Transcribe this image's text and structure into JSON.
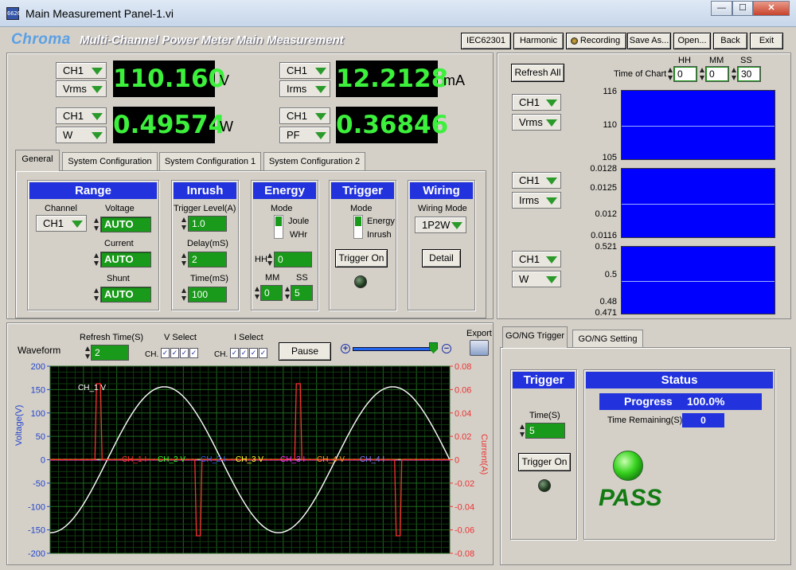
{
  "window": {
    "title": "Main Measurement Panel-1.vi",
    "icon_text": "6626",
    "min": "—",
    "restore": "☐",
    "close": "✕"
  },
  "header": {
    "logo": "Chroma",
    "title": "Multi-Channel Power Meter Main Measurement",
    "buttons": [
      "IEC62301",
      "Harmonic",
      "Recording",
      "Save As...",
      "Open...",
      "Back",
      "Exit"
    ]
  },
  "meters": [
    {
      "channel": "CH1",
      "param": "Vrms",
      "value": "110.160",
      "unit": "V"
    },
    {
      "channel": "CH1",
      "param": "Irms",
      "value": "12.2128",
      "unit": "mA"
    },
    {
      "channel": "CH1",
      "param": "W",
      "value": "0.49574",
      "unit": "W"
    },
    {
      "channel": "CH1",
      "param": "PF",
      "value": "0.36846",
      "unit": ""
    }
  ],
  "tabs": [
    "General",
    "System Configuration",
    "System Configuration 1",
    "System Configuration 2"
  ],
  "range": {
    "title": "Range",
    "channel_label": "Channel",
    "channel": "CH1",
    "voltage_label": "Voltage",
    "voltage": "AUTO",
    "current_label": "Current",
    "current": "AUTO",
    "shunt_label": "Shunt",
    "shunt": "AUTO"
  },
  "inrush": {
    "title": "Inrush",
    "trigger_label": "Trigger Level(A)",
    "trigger": "1.0",
    "delay_label": "Delay(mS)",
    "delay": "2",
    "time_label": "Time(mS)",
    "time": "100"
  },
  "energy": {
    "title": "Energy",
    "mode_label": "Mode",
    "opt1": "Joule",
    "opt2": "WHr",
    "hh_label": "HH",
    "hh": "0",
    "mm_label": "MM",
    "mm": "0",
    "ss_label": "SS",
    "ss": "5"
  },
  "trigger": {
    "title": "Trigger",
    "mode_label": "Mode",
    "opt1": "Energy",
    "opt2": "Inrush",
    "button": "Trigger On"
  },
  "wiring": {
    "title": "Wiring",
    "mode_label": "Wiring Mode",
    "mode": "1P2W",
    "button": "Detail"
  },
  "trend": {
    "refresh": "Refresh All",
    "time_label": "Time of Chart",
    "hh_label": "HH",
    "hh": "0",
    "mm_label": "MM",
    "mm": "0",
    "ss_label": "SS",
    "ss": "30",
    "charts": [
      {
        "channel": "CH1",
        "param": "Vrms",
        "ticks": [
          "116",
          "110",
          "105"
        ]
      },
      {
        "channel": "CH1",
        "param": "Irms",
        "ticks": [
          "0.0128",
          "0.0125",
          "0.012",
          "0.0116"
        ]
      },
      {
        "channel": "CH1",
        "param": "W",
        "ticks": [
          "0.521",
          "0.5",
          "0.48",
          "0.471"
        ]
      }
    ]
  },
  "waveform": {
    "title": "Waveform",
    "refresh_label": "Refresh Time(S)",
    "refresh": "2",
    "vsel_label": "V Select",
    "isel_label": "I Select",
    "ch_label": "CH.",
    "pause": "Pause",
    "export": "Export",
    "ylabel": "Voltage(V)",
    "y2label": "Current(A)",
    "yticks": [
      "200",
      "150",
      "100",
      "50",
      "0",
      "-50",
      "-100",
      "-150",
      "-200"
    ],
    "y2ticks": [
      "0.08",
      "0.06",
      "0.04",
      "0.02",
      "0",
      "-0.02",
      "-0.04",
      "-0.06",
      "-0.08"
    ],
    "trace_labels": [
      "CH_1 V",
      "CH_1 I",
      "CH_2 V",
      "CH_2 I",
      "CH_3 V",
      "CH_3 I",
      "CH_4 V",
      "CH_4 I"
    ],
    "trace_colors": [
      "#ffffff",
      "#ff3030",
      "#30ff30",
      "#3060ff",
      "#ffff30",
      "#ff30ff",
      "#ffa020",
      "#8080ff"
    ]
  },
  "chart_data": {
    "type": "line",
    "xlabel": "",
    "ylabel": "Voltage(V)",
    "y2label": "Current(A)",
    "ylim": [
      -200,
      200
    ],
    "y2lim": [
      -0.08,
      0.08
    ],
    "series": [
      {
        "name": "CH_1 V",
        "axis": "left",
        "shape": "sine",
        "amplitude": 156,
        "cycles": 1.75,
        "phase_start": -90
      },
      {
        "name": "CH_1 I",
        "axis": "right",
        "shape": "pulses",
        "peak": 0.065,
        "pulse_positions": [
          0.12,
          0.37,
          0.62,
          0.87
        ],
        "pulse_signs": [
          1,
          -1,
          1,
          -1
        ]
      }
    ],
    "grid": true
  },
  "gonogo": {
    "tabs": [
      "GO/NG Trigger",
      "GO/NG Setting"
    ],
    "trigger_title": "Trigger",
    "time_label": "Time(S)",
    "time": "5",
    "button": "Trigger On",
    "status_title": "Status",
    "progress_label": "Progress",
    "progress": "100.0%",
    "remaining_label": "Time Remaining(S)=",
    "remaining": "0",
    "result": "PASS"
  }
}
